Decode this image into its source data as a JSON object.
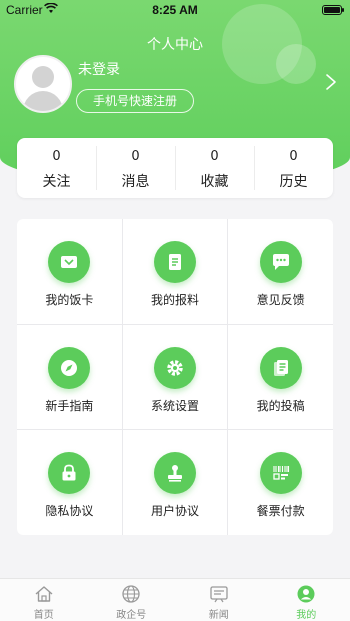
{
  "status_bar": {
    "carrier": "Carrier",
    "time": "8:25 AM"
  },
  "header": {
    "title": "个人中心",
    "login_status": "未登录",
    "register_label": "手机号快速注册"
  },
  "stats": [
    {
      "value": "0",
      "label": "关注"
    },
    {
      "value": "0",
      "label": "消息"
    },
    {
      "value": "0",
      "label": "收藏"
    },
    {
      "value": "0",
      "label": "历史"
    }
  ],
  "menu": [
    {
      "label": "我的饭卡",
      "icon": "card-icon"
    },
    {
      "label": "我的报料",
      "icon": "document-icon"
    },
    {
      "label": "意见反馈",
      "icon": "chat-icon"
    },
    {
      "label": "新手指南",
      "icon": "compass-icon"
    },
    {
      "label": "系统设置",
      "icon": "gear-icon"
    },
    {
      "label": "我的投稿",
      "icon": "submission-icon"
    },
    {
      "label": "隐私协议",
      "icon": "lock-icon"
    },
    {
      "label": "用户协议",
      "icon": "stamp-icon"
    },
    {
      "label": "餐票付款",
      "icon": "barcode-icon"
    }
  ],
  "tabs": [
    {
      "label": "首页",
      "icon": "home-icon",
      "active": false
    },
    {
      "label": "政企号",
      "icon": "globe-icon",
      "active": false
    },
    {
      "label": "新闻",
      "icon": "news-icon",
      "active": false
    },
    {
      "label": "我的",
      "icon": "profile-icon",
      "active": true
    }
  ],
  "colors": {
    "accent": "#5ccc5b",
    "header": "#6bd468",
    "inactive_tab": "#888888"
  }
}
